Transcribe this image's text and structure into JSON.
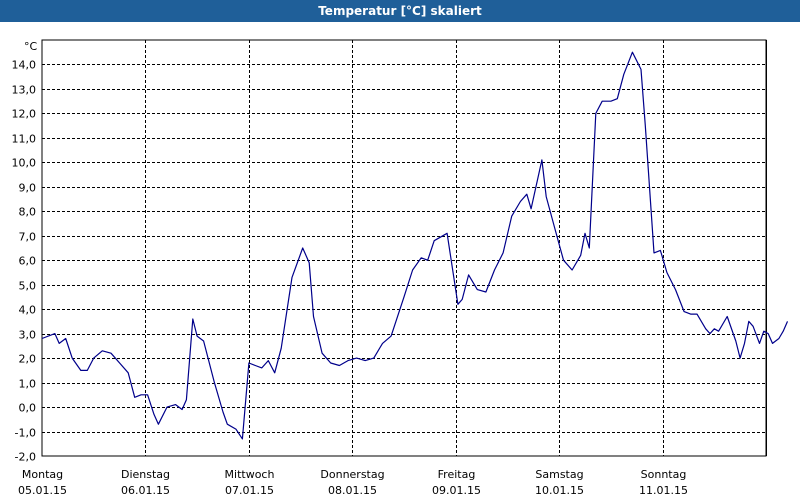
{
  "window": {
    "title": "Temperatur [°C] skaliert"
  },
  "chart_data": {
    "type": "line",
    "title": "Temperatur [°C] skaliert",
    "ylabel": "",
    "y_unit": "°C",
    "ylim": [
      -2.0,
      15.0
    ],
    "ytick_values": [
      -2.0,
      -1.0,
      0.0,
      1.0,
      2.0,
      3.0,
      4.0,
      5.0,
      6.0,
      7.0,
      8.0,
      9.0,
      10.0,
      11.0,
      12.0,
      13.0,
      14.0
    ],
    "ytick_labels": [
      "-2,0",
      "-1,0",
      "0,0",
      "1,0",
      "2,0",
      "3,0",
      "4,0",
      "5,0",
      "6,0",
      "7,0",
      "8,0",
      "9,0",
      "10,0",
      "11,0",
      "12,0",
      "13,0",
      "14,0"
    ],
    "xlim": [
      "05.01.15 00:00",
      "12.01.15 00:00"
    ],
    "x_categories": [
      {
        "day": "Montag",
        "date": "05.01.15"
      },
      {
        "day": "Dienstag",
        "date": "06.01.15"
      },
      {
        "day": "Mittwoch",
        "date": "07.01.15"
      },
      {
        "day": "Donnerstag",
        "date": "08.01.15"
      },
      {
        "day": "Freitag",
        "date": "09.01.15"
      },
      {
        "day": "Samstag",
        "date": "10.01.15"
      },
      {
        "day": "Sonntag",
        "date": "11.01.15"
      }
    ],
    "grid": true,
    "series": [
      {
        "color": "#00008b",
        "points": [
          [
            "05.01.15 00:00",
            2.8
          ],
          [
            "05.01.15 03:00",
            3.0
          ],
          [
            "05.01.15 04:00",
            2.6
          ],
          [
            "05.01.15 05:30",
            2.8
          ],
          [
            "05.01.15 07:00",
            2.0
          ],
          [
            "05.01.15 09:00",
            1.5
          ],
          [
            "05.01.15 10:30",
            1.5
          ],
          [
            "05.01.15 12:00",
            2.0
          ],
          [
            "05.01.15 14:00",
            2.3
          ],
          [
            "05.01.15 16:00",
            2.2
          ],
          [
            "05.01.15 18:00",
            1.8
          ],
          [
            "05.01.15 20:00",
            1.4
          ],
          [
            "05.01.15 21:30",
            0.4
          ],
          [
            "05.01.15 23:00",
            0.5
          ],
          [
            "06.01.15 00:30",
            0.5
          ],
          [
            "06.01.15 02:00",
            -0.3
          ],
          [
            "06.01.15 03:00",
            -0.7
          ],
          [
            "06.01.15 05:00",
            0.0
          ],
          [
            "06.01.15 07:00",
            0.1
          ],
          [
            "06.01.15 08:30",
            -0.1
          ],
          [
            "06.01.15 09:30",
            0.3
          ],
          [
            "06.01.15 11:00",
            3.6
          ],
          [
            "06.01.15 12:00",
            2.9
          ],
          [
            "06.01.15 13:30",
            2.7
          ],
          [
            "06.01.15 16:00",
            1.0
          ],
          [
            "06.01.15 18:00",
            -0.2
          ],
          [
            "06.01.15 19:00",
            -0.7
          ],
          [
            "06.01.15 21:00",
            -0.9
          ],
          [
            "06.01.15 22:30",
            -1.3
          ],
          [
            "07.01.15 00:00",
            1.8
          ],
          [
            "07.01.15 01:30",
            1.7
          ],
          [
            "07.01.15 03:00",
            1.6
          ],
          [
            "07.01.15 04:30",
            1.9
          ],
          [
            "07.01.15 06:00",
            1.4
          ],
          [
            "07.01.15 07:30",
            2.4
          ],
          [
            "07.01.15 10:00",
            5.3
          ],
          [
            "07.01.15 12:30",
            6.5
          ],
          [
            "07.01.15 14:00",
            5.9
          ],
          [
            "07.01.15 15:00",
            3.7
          ],
          [
            "07.01.15 17:00",
            2.2
          ],
          [
            "07.01.15 19:00",
            1.8
          ],
          [
            "07.01.15 21:00",
            1.7
          ],
          [
            "07.01.15 23:00",
            1.9
          ],
          [
            "08.01.15 01:00",
            2.0
          ],
          [
            "08.01.15 03:00",
            1.9
          ],
          [
            "08.01.15 05:00",
            2.0
          ],
          [
            "08.01.15 07:00",
            2.6
          ],
          [
            "08.01.15 09:00",
            2.9
          ],
          [
            "08.01.15 12:00",
            4.5
          ],
          [
            "08.01.15 14:00",
            5.6
          ],
          [
            "08.01.15 16:00",
            6.1
          ],
          [
            "08.01.15 17:30",
            6.0
          ],
          [
            "08.01.15 19:00",
            6.8
          ],
          [
            "08.01.15 22:00",
            7.1
          ],
          [
            "09.01.15 00:30",
            4.2
          ],
          [
            "09.01.15 01:30",
            4.4
          ],
          [
            "09.01.15 03:00",
            5.4
          ],
          [
            "09.01.15 05:00",
            4.8
          ],
          [
            "09.01.15 07:00",
            4.7
          ],
          [
            "09.01.15 09:00",
            5.6
          ],
          [
            "09.01.15 11:00",
            6.3
          ],
          [
            "09.01.15 13:00",
            7.8
          ],
          [
            "09.01.15 15:00",
            8.4
          ],
          [
            "09.01.15 16:30",
            8.7
          ],
          [
            "09.01.15 17:30",
            8.1
          ],
          [
            "09.01.15 20:00",
            10.1
          ],
          [
            "09.01.15 21:00",
            8.6
          ],
          [
            "09.01.15 23:00",
            7.3
          ],
          [
            "10.01.15 01:00",
            6.0
          ],
          [
            "10.01.15 03:00",
            5.6
          ],
          [
            "10.01.15 05:00",
            6.2
          ],
          [
            "10.01.15 06:00",
            7.1
          ],
          [
            "10.01.15 07:00",
            6.5
          ],
          [
            "10.01.15 08:30",
            12.0
          ],
          [
            "10.01.15 10:00",
            12.5
          ],
          [
            "10.01.15 12:00",
            12.5
          ],
          [
            "10.01.15 13:30",
            12.6
          ],
          [
            "10.01.15 15:00",
            13.6
          ],
          [
            "10.01.15 17:00",
            14.5
          ],
          [
            "10.01.15 19:00",
            13.8
          ],
          [
            "10.01.15 20:00",
            11.5
          ],
          [
            "10.01.15 22:00",
            6.3
          ],
          [
            "10.01.15 23:30",
            6.4
          ],
          [
            "11.01.15 01:00",
            5.5
          ],
          [
            "11.01.15 03:00",
            4.8
          ],
          [
            "11.01.15 05:00",
            3.9
          ],
          [
            "11.01.15 06:30",
            3.8
          ],
          [
            "11.01.15 08:00",
            3.8
          ],
          [
            "11.01.15 10:00",
            3.2
          ],
          [
            "11.01.15 11:00",
            3.0
          ],
          [
            "11.01.15 12:00",
            3.2
          ],
          [
            "11.01.15 13:00",
            3.1
          ],
          [
            "11.01.15 15:00",
            3.7
          ],
          [
            "11.01.15 17:00",
            2.7
          ],
          [
            "11.01.15 18:00",
            2.0
          ],
          [
            "11.01.15 19:00",
            2.6
          ],
          [
            "11.01.15 20:00",
            3.5
          ],
          [
            "11.01.15 21:00",
            3.3
          ],
          [
            "11.01.15 22:30",
            2.6
          ],
          [
            "11.01.15 23:30",
            3.1
          ],
          [
            "12.01.15 00:30",
            3.0
          ],
          [
            "12.01.15 01:30",
            2.6
          ],
          [
            "12.01.15 03:00",
            2.8
          ],
          [
            "12.01.15 04:00",
            3.1
          ],
          [
            "12.01.15 05:00",
            3.5
          ]
        ]
      }
    ]
  }
}
